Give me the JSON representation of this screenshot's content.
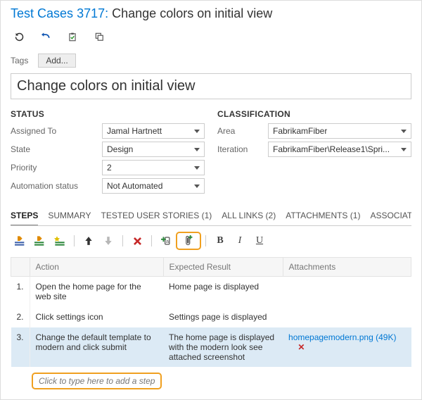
{
  "header": {
    "type_label": "Test Cases",
    "id": "3717",
    "title_suffix": "Change colors on initial view"
  },
  "tags": {
    "label": "Tags",
    "add_label": "Add..."
  },
  "title_field": {
    "value": "Change colors on initial view"
  },
  "status": {
    "heading": "STATUS",
    "fields": {
      "assigned_to": {
        "label": "Assigned To",
        "value": "Jamal Hartnett"
      },
      "state": {
        "label": "State",
        "value": "Design"
      },
      "priority": {
        "label": "Priority",
        "value": "2"
      },
      "automation_status": {
        "label": "Automation status",
        "value": "Not Automated"
      }
    }
  },
  "classification": {
    "heading": "CLASSIFICATION",
    "fields": {
      "area": {
        "label": "Area",
        "value": "FabrikamFiber"
      },
      "iteration": {
        "label": "Iteration",
        "value": "FabrikamFiber\\Release1\\Spri..."
      }
    }
  },
  "tabs": {
    "steps": "STEPS",
    "summary": "SUMMARY",
    "tested": "TESTED USER STORIES (1)",
    "links": "ALL LINKS (2)",
    "attachments": "ATTACHMENTS (1)",
    "automation": "ASSOCIATED AUTOMAT..."
  },
  "grid": {
    "col_action": "Action",
    "col_expected": "Expected Result",
    "col_attach": "Attachments",
    "rows": [
      {
        "n": "1.",
        "action": "Open the home page for the web site",
        "expected": "Home page is displayed",
        "attach": ""
      },
      {
        "n": "2.",
        "action": "Click settings icon",
        "expected": "Settings page is displayed",
        "attach": ""
      },
      {
        "n": "3.",
        "action": "Change the default template to modern and click submit",
        "expected": "The home page is displayed with the modern look see attached screenshot",
        "attach": "homepagemodern.png (49K)"
      }
    ],
    "add_step_placeholder": "Click to type here to add a step"
  }
}
